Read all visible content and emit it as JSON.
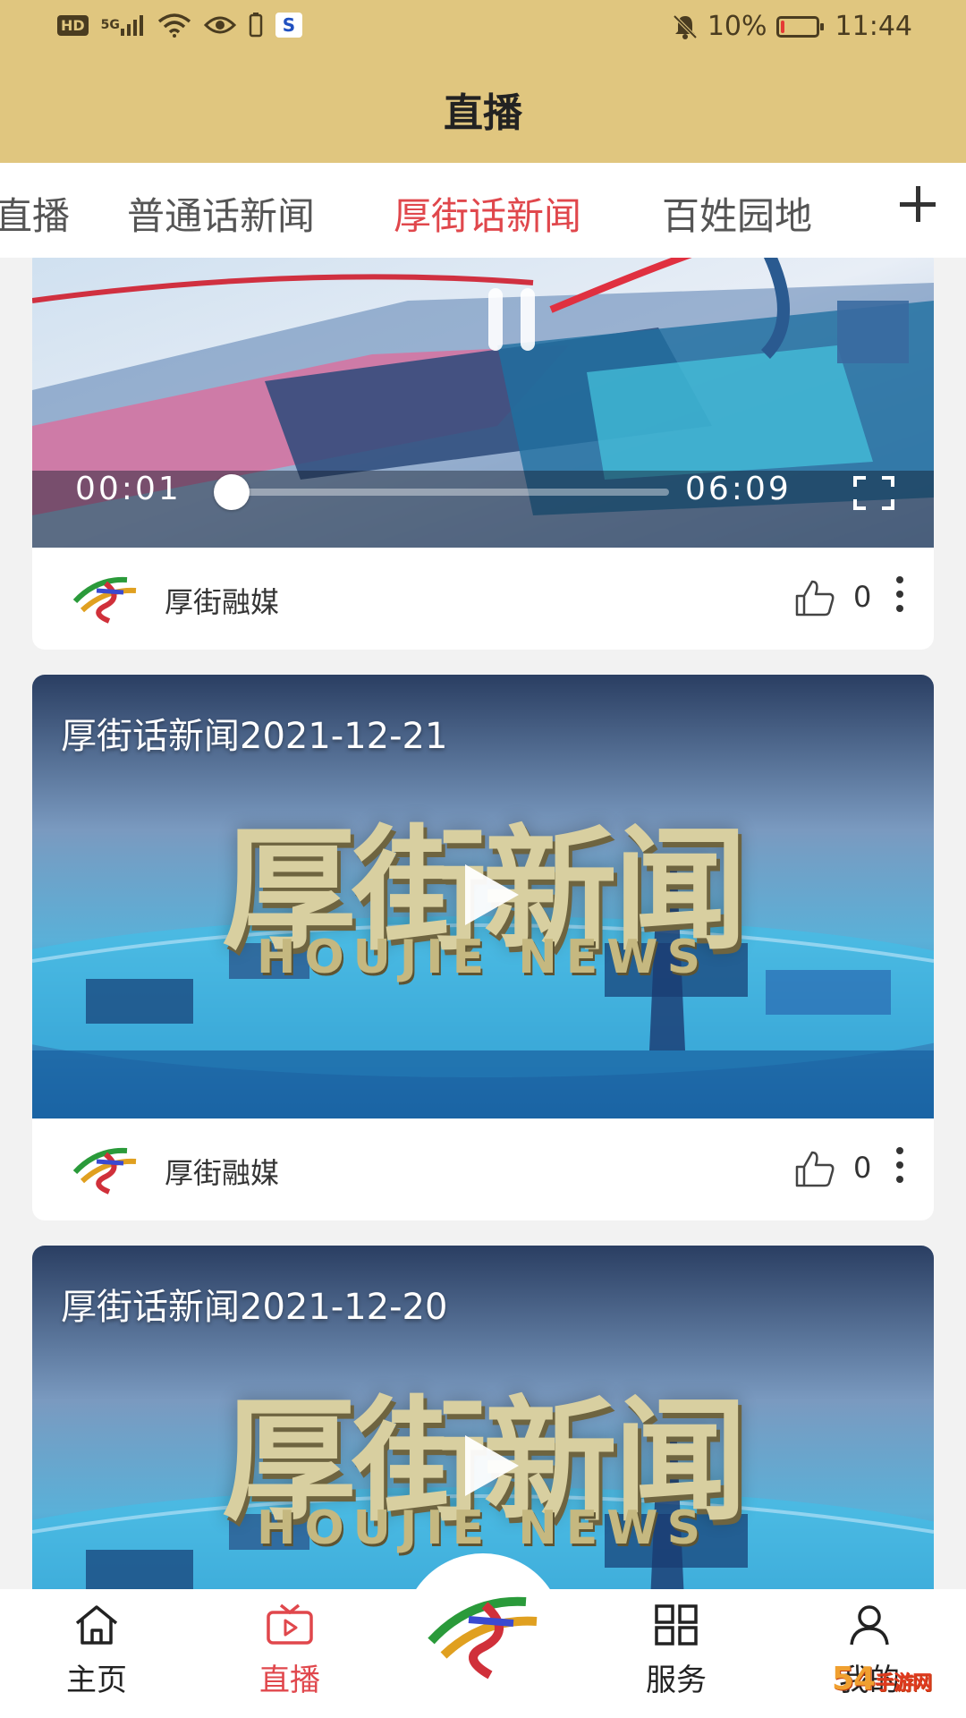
{
  "status_bar": {
    "left_icons": [
      "hd-icon",
      "signal-5g-icon",
      "wifi-icon",
      "eye-icon",
      "phone-battery-icon",
      "app-badge-icon"
    ],
    "hd_label": "HD",
    "signal_label": "5G",
    "battery_percent": "10%",
    "battery_level": 0.1,
    "time": "11:44"
  },
  "header": {
    "title": "直播"
  },
  "tabs": [
    {
      "label": "直播",
      "active": false
    },
    {
      "label": "普通话新闻",
      "active": false
    },
    {
      "label": "厚街话新闻",
      "active": true
    },
    {
      "label": "百姓园地",
      "active": false
    }
  ],
  "cards": [
    {
      "type": "playing",
      "current_time": "00:01",
      "duration": "06:09",
      "progress": 0.003,
      "source": "厚街融媒",
      "likes": "0"
    },
    {
      "type": "thumbnail",
      "title": "厚街话新闻2021-12-21",
      "thumb_text_cn": "厚街新闻",
      "thumb_text_en": "HOUJIE NEWS",
      "source": "厚街融媒",
      "likes": "0"
    },
    {
      "type": "thumbnail",
      "title": "厚街话新闻2021-12-20",
      "thumb_text_cn": "厚街新闻",
      "thumb_text_en": "HOUJIE NEWS"
    }
  ],
  "bottom_nav": [
    {
      "label": "主页",
      "icon": "home-icon",
      "active": false
    },
    {
      "label": "直播",
      "icon": "tv-icon",
      "active": true
    },
    {
      "label": "服务",
      "icon": "grid-icon",
      "active": false
    },
    {
      "label": "我的",
      "icon": "user-icon",
      "active": false
    }
  ],
  "watermark": {
    "text": "54",
    "sub": "手游网"
  },
  "colors": {
    "header_bg": "#e0c67f",
    "accent": "#e0474c",
    "page_bg": "#f2f2f2"
  }
}
